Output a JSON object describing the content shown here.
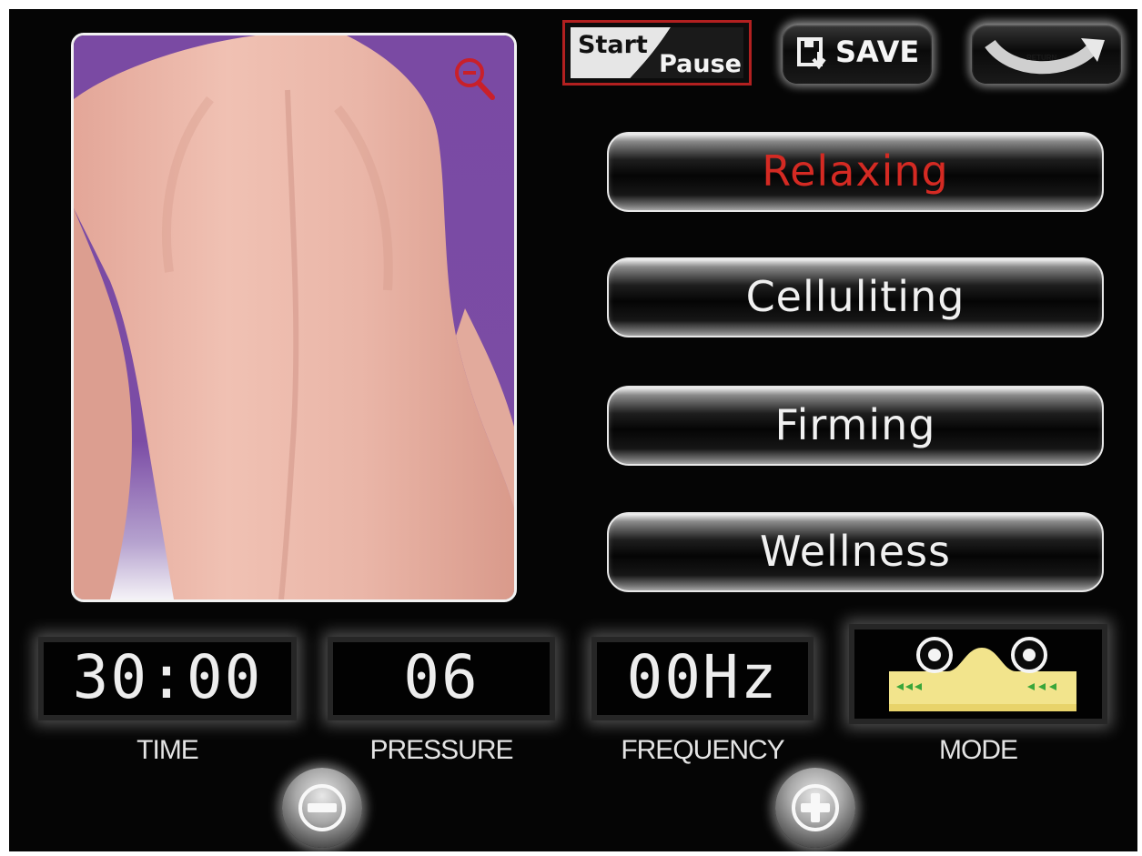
{
  "top_bar": {
    "start_label": "Start",
    "pause_label": "Pause",
    "save_label": "SAVE",
    "return_label": "RETURN"
  },
  "image_panel": {
    "body_area": "back",
    "zoom_icon": "zoom-in-icon"
  },
  "programs": [
    {
      "label": "Relaxing",
      "active": true
    },
    {
      "label": "Celluliting",
      "active": false
    },
    {
      "label": "Firming",
      "active": false
    },
    {
      "label": "Wellness",
      "active": false
    }
  ],
  "readouts": {
    "time": {
      "value": "30:00",
      "label": "TIME"
    },
    "pressure": {
      "value": "06",
      "label": "PRESSURE"
    },
    "frequency": {
      "value": "00Hz",
      "label": "FREQUENCY"
    },
    "mode": {
      "label": "MODE",
      "icon": "roller-massage-mode-icon"
    }
  },
  "controls": {
    "decrease_icon": "minus-icon",
    "increase_icon": "plus-icon"
  },
  "colors": {
    "background": "#050505",
    "active_program": "#d42a23",
    "start_pause_border": "#b22020",
    "panel_purple": "#7a4aa3",
    "mode_roller_fill": "#f2e48c"
  }
}
